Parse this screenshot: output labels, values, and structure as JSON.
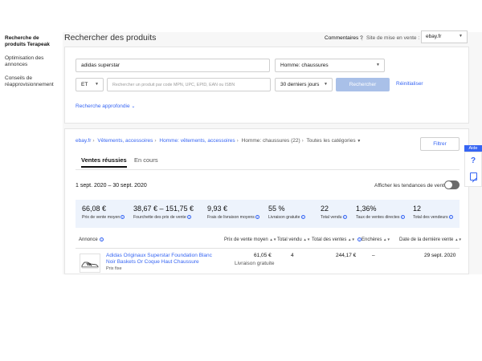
{
  "sidebar": {
    "items": [
      {
        "label": "Recherche de produits Terapeak",
        "active": true
      },
      {
        "label": "Optimisation des annonces",
        "active": false
      },
      {
        "label": "Conseils de réapprovisionnement",
        "active": false
      }
    ]
  },
  "header": {
    "title": "Rechercher des produits",
    "comments_link": "Commentaires ?",
    "separator": "|",
    "site_label": "Site de mise en vente :",
    "site_value": "ebay.fr"
  },
  "search": {
    "query": "adidas superstar",
    "category_value": "Homme: chaussures",
    "operator_value": "ET",
    "secondary_placeholder": "Rechercher un produit par code MPN, UPC, EPID, EAN ou ISBN",
    "period_value": "30 derniers jours",
    "search_button": "Rechercher",
    "reset_link": "Réinitialiser",
    "advanced_link": "Recherche approfondie"
  },
  "breadcrumb": {
    "items": [
      "ebay.fr",
      "Vêtements, accessoires",
      "Homme: vêtements, accessoires",
      "Homme: chaussures (22)"
    ],
    "all_categories": "Toutes les catégories"
  },
  "filter_button": "Filtrer",
  "tabs": [
    {
      "label": "Ventes réussies",
      "active": true
    },
    {
      "label": "En cours",
      "active": false
    }
  ],
  "date_range": "1 sept. 2020 – 30 sept. 2020",
  "trend_toggle_label": "Afficher les tendances de vente",
  "kpis": [
    {
      "value": "66,08 €",
      "label": "Prix de vente moyen"
    },
    {
      "value": "38,67 € – 151,75 €",
      "label": "Fourchette des prix de vente"
    },
    {
      "value": "9,93 €",
      "label": "Frais de livraison moyens"
    },
    {
      "value": "55 %",
      "label": "Livraison gratuite"
    },
    {
      "value": "22",
      "label": "Total vendu"
    },
    {
      "value": "1,36%",
      "label": "Taux de ventes directes"
    },
    {
      "value": "12",
      "label": "Total des vendeurs"
    }
  ],
  "table": {
    "headers": {
      "listing": "Annonce",
      "avg_price": "Prix de vente moyen",
      "total_sold": "Total vendu",
      "total_sales": "Total des ventes",
      "bids": "Enchères",
      "last_sale": "Date de la dernière vente"
    },
    "rows": [
      {
        "title": "Adidas Originaux Superstar Foundation Blanc Noir Baskets Or Coque Haut Chaussure",
        "format": "Prix fixe",
        "avg_price": "61,05 €",
        "shipping": "Livraison gratuite",
        "total_sold": "4",
        "total_sales": "244,17 €",
        "bids": "–",
        "last_sale": "29 sept. 2020"
      }
    ]
  },
  "help": {
    "tab": "Aide",
    "question_glyph": "?"
  },
  "colors": {
    "link": "#3665f3",
    "search_button": "#a9c0e8",
    "kpi_background": "#edf3fc",
    "toggle_off": "#6b6b6b"
  }
}
